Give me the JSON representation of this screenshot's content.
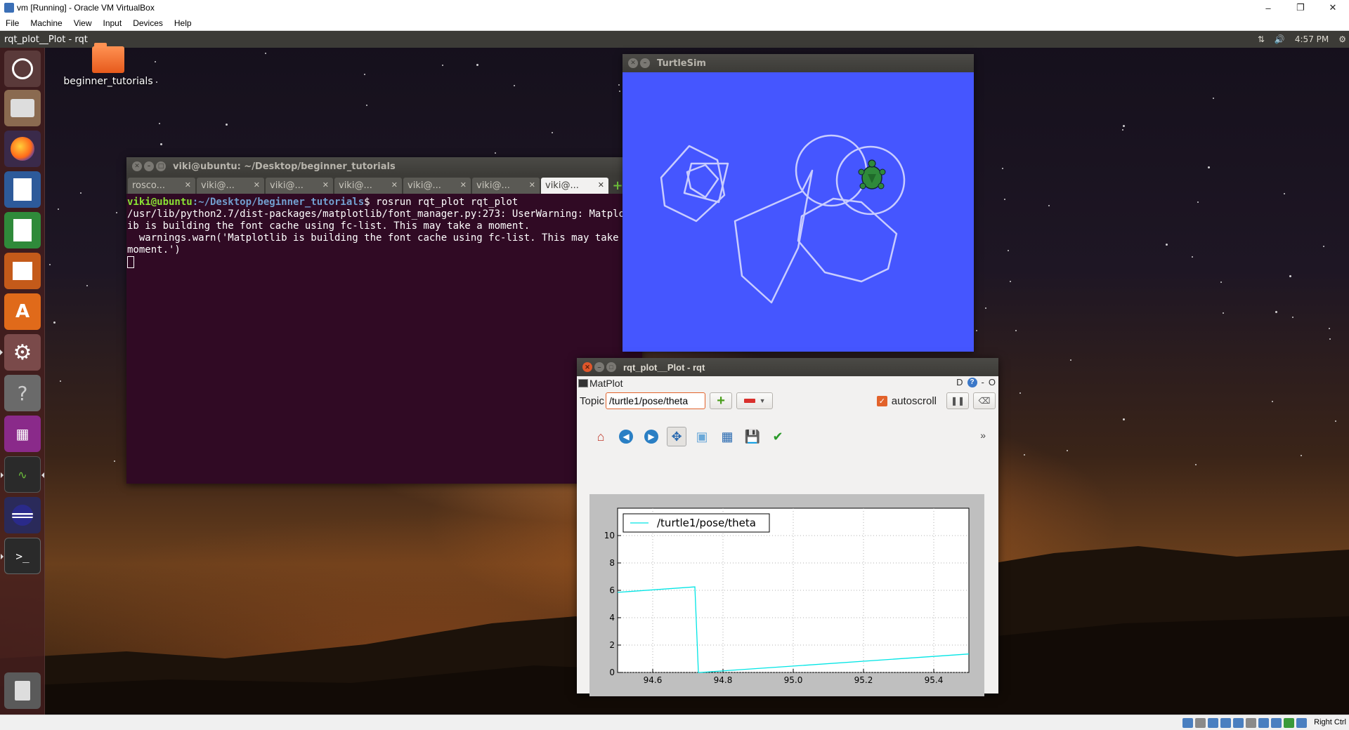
{
  "host": {
    "title": "vm [Running] - Oracle VM VirtualBox",
    "menu": [
      "File",
      "Machine",
      "View",
      "Input",
      "Devices",
      "Help"
    ],
    "minimize_icon": "minimize-icon",
    "maximize_icon": "restore-icon",
    "close_icon": "close-icon",
    "host_key": "Right Ctrl"
  },
  "guest": {
    "panel": {
      "title": "rqt_plot__Plot - rqt",
      "time": "4:57 PM"
    },
    "launcher": [
      "ubuntu-dash",
      "files",
      "firefox",
      "libreoffice-writer",
      "libreoffice-calc",
      "libreoffice-impress",
      "software-center",
      "system-settings",
      "help",
      "workspace-switcher",
      "system-monitor",
      "eclipse",
      "terminal",
      "trash"
    ],
    "desktop_icon": {
      "label": "beginner_tutorials"
    },
    "terminal": {
      "title": "viki@ubuntu: ~/Desktop/beginner_tutorials",
      "tabs": [
        "rosco...",
        "viki@...",
        "viki@...",
        "viki@...",
        "viki@...",
        "viki@...",
        "viki@..."
      ],
      "prompt_user": "viki@ubuntu",
      "prompt_path": ":~/Desktop/beginner_tutorials",
      "command": "$ rosrun rqt_plot rqt_plot",
      "output": "/usr/lib/python2.7/dist-packages/matplotlib/font_manager.py:273: UserWarning: Matplotlib is building the font cache using fc-list. This may take a moment.\n  warnings.warn('Matplotlib is building the font cache using fc-list. This may take a moment.')"
    },
    "turtlesim": {
      "title": "TurtleSim",
      "background": "#4556ff"
    },
    "rqt": {
      "title": "rqt_plot__Plot - rqt",
      "plugin": "MatPlot",
      "plugin_buttons": {
        "d": "D",
        "minus": "-",
        "o": "O",
        "help": "?"
      },
      "topic_label": "Topic",
      "topic_value": "/turtle1/pose/theta",
      "autoscroll_label": "autoscroll",
      "autoscroll_checked": true,
      "toolbar_more": "»"
    }
  },
  "chart_data": {
    "type": "line",
    "title": "",
    "xlabel": "",
    "ylabel": "",
    "xlim": [
      94.5,
      95.5
    ],
    "ylim": [
      0,
      12
    ],
    "xticks": [
      "94.6",
      "94.8",
      "95.0",
      "95.2",
      "95.4"
    ],
    "yticks": [
      "0",
      "2",
      "4",
      "6",
      "8",
      "10"
    ],
    "legend": {
      "placement": "top-left",
      "entries": [
        "/turtle1/pose/theta"
      ]
    },
    "grid": true,
    "series": [
      {
        "name": "/turtle1/pose/theta",
        "color": "#00e5e5",
        "x": [
          94.5,
          94.72,
          94.73,
          94.735,
          95.5
        ],
        "y": [
          5.85,
          6.25,
          0.0,
          0.0,
          1.35
        ]
      }
    ]
  }
}
